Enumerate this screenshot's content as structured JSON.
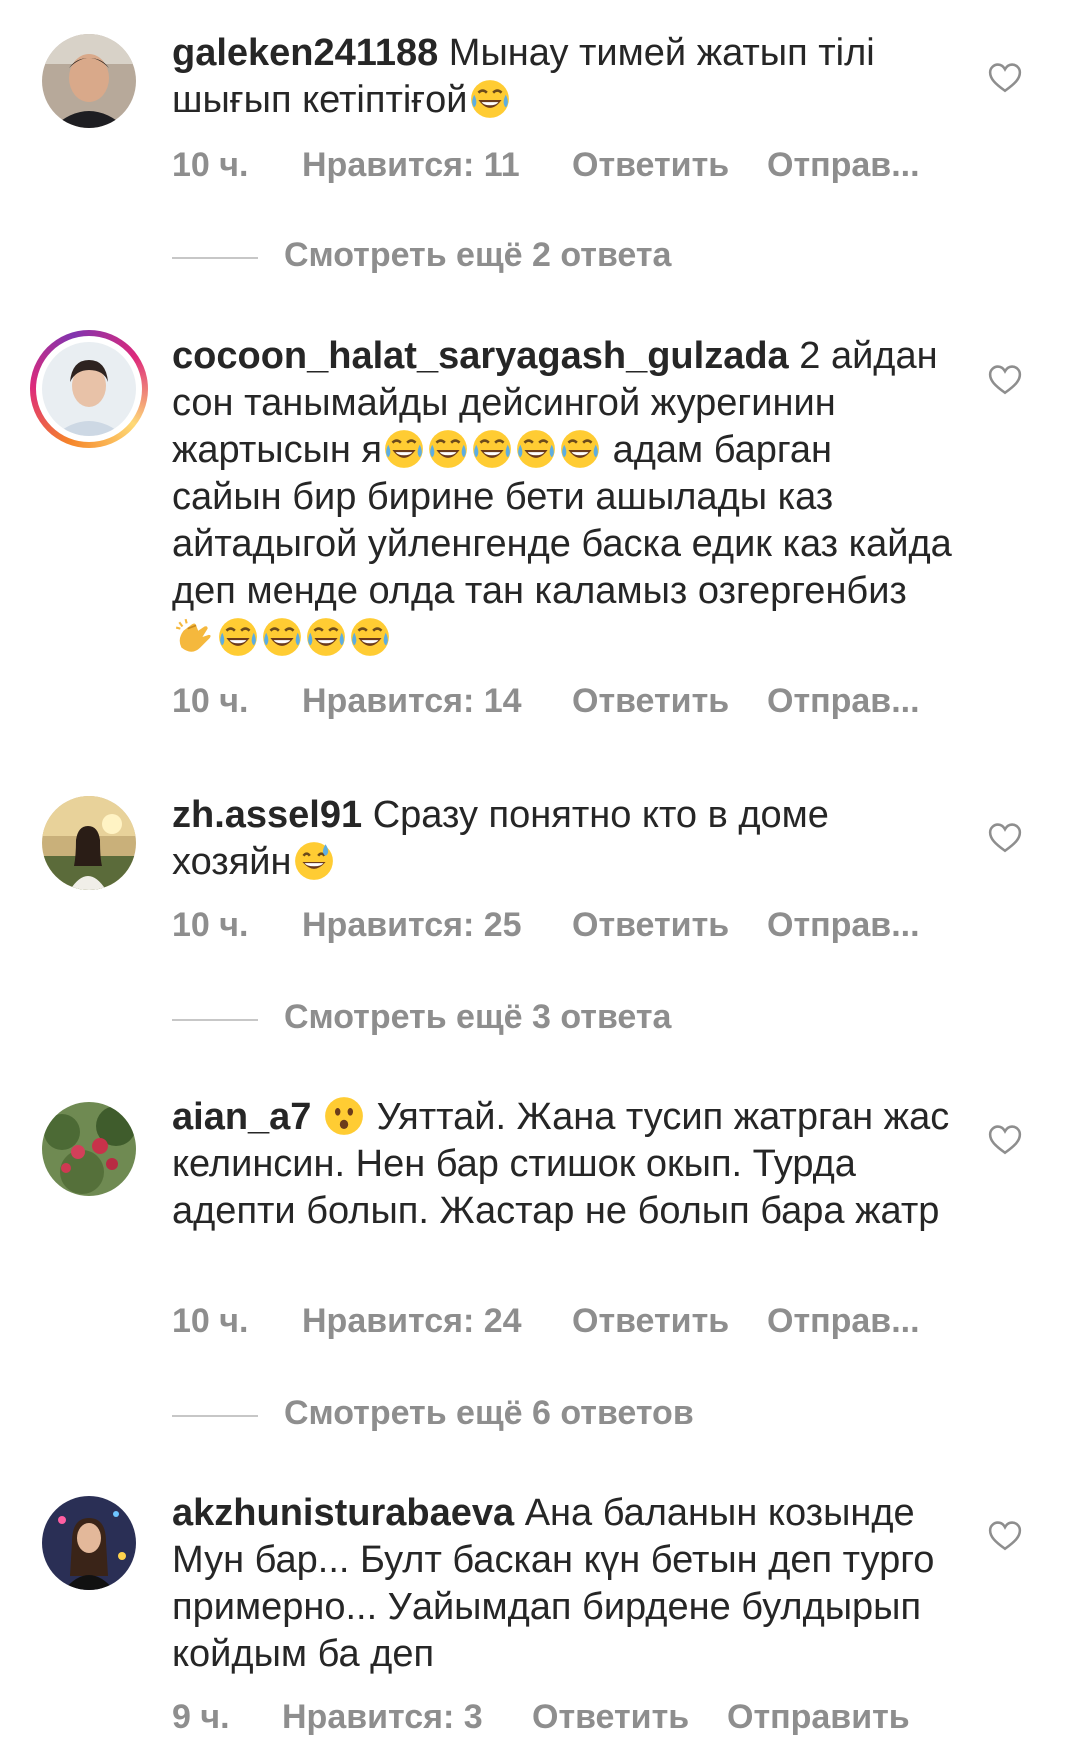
{
  "comments": [
    {
      "username": "galeken241188",
      "text": "Мынау тимей жатып тілі шығып кетіптіғой",
      "emoji_after": [
        "tears-of-joy"
      ],
      "time": "10 ч.",
      "likes": "Нравится: 11",
      "reply": "Ответить",
      "send": "Отправ..."
    },
    {
      "username": "cocoon_halat_saryagash_gulzada",
      "text_1": "2 айдан сон танымайды дейсингой журегинин жартысын я",
      "emoji_mid": [
        "tears-of-joy",
        "tears-of-joy",
        "tears-of-joy",
        "tears-of-joy",
        "tears-of-joy"
      ],
      "text_2": "адам барган сайын бир бирине бети ашылады каз айтадыгой уйленгенде баска едик каз кайда деп менде олда тан каламыз озгергенбиз",
      "emoji_after": [
        "clapping-hands",
        "tears-of-joy",
        "tears-of-joy",
        "tears-of-joy",
        "tears-of-joy"
      ],
      "time": "10 ч.",
      "likes": "Нравится: 14",
      "reply": "Ответить",
      "send": "Отправ..."
    },
    {
      "username": "zh.assel91",
      "text": "Сразу понятно кто в доме хозяйн",
      "emoji_after": [
        "grinning-sweat"
      ],
      "time": "10 ч.",
      "likes": "Нравится: 25",
      "reply": "Ответить",
      "send": "Отправ..."
    },
    {
      "username": "aian_a7",
      "emoji_before": [
        "hushed-face"
      ],
      "text": "Уяттай. Жана тусип жатрган жас келинсин. Нен бар стишок окып. Турда адепти болып. Жастар не болып бара жатр",
      "time": "10 ч.",
      "likes": "Нравится: 24",
      "reply": "Ответить",
      "send": "Отправ..."
    },
    {
      "username": "akzhunisturabaeva",
      "text": "Ана баланын козынде Мун бар... Булт баскан күн бетын деп турго примерно... Уайымдап бирдене булдырып койдым ба деп",
      "time": "9 ч.",
      "likes": "Нравится: 3",
      "reply": "Ответить",
      "send": "Отправить"
    }
  ],
  "view_more": [
    "Смотреть ещё 2 ответа",
    "Смотреть ещё 3 ответа",
    "Смотреть ещё 6 ответов"
  ],
  "colors": {
    "text": "#262626",
    "secondary": "#8e8e8e",
    "divider": "#c7c7c7",
    "heart_outline": "#8e8e8e",
    "emoji_yellow": "#ffcc33",
    "emoji_tear": "#5dade2"
  },
  "icons": {
    "like": "heart-outline-icon"
  }
}
